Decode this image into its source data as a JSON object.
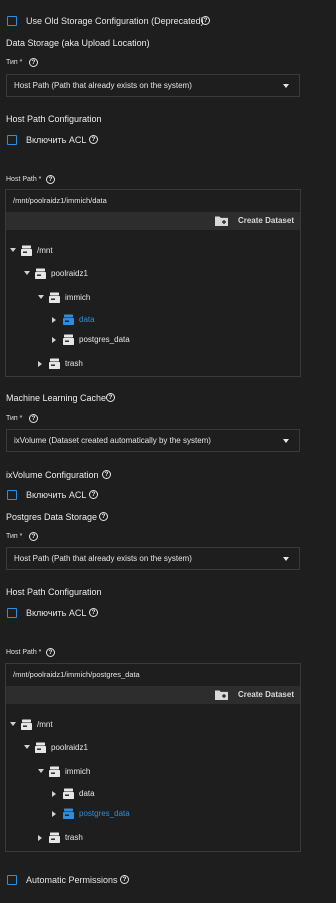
{
  "accent_color": "#2f8ddd",
  "old_storage": {
    "label": "Use Old Storage Configuration (Deprecated)",
    "checked": false
  },
  "data_storage": {
    "title": "Data Storage (aka Upload Location)",
    "type_label": "Тип *",
    "type_value": "Host Path (Path that already exists on the system)",
    "host_path_config_title": "Host Path Configuration",
    "acl_label": "Включить ACL",
    "host_path_label": "Host Path *",
    "host_path_value": "/mnt/poolraidz1/immich/data",
    "create_dataset_label": "Create Dataset",
    "tree": [
      {
        "name": "/mnt",
        "expanded": true,
        "selected": false
      },
      {
        "name": "poolraidz1",
        "expanded": true,
        "selected": false
      },
      {
        "name": "immich",
        "expanded": true,
        "selected": false
      },
      {
        "name": "data",
        "expanded": false,
        "selected": true
      },
      {
        "name": "postgres_data",
        "expanded": false,
        "selected": false
      },
      {
        "name": "trash",
        "expanded": false,
        "selected": false
      }
    ]
  },
  "ml_cache": {
    "title": "Machine Learning Cache",
    "type_label": "Тип *",
    "type_value": "ixVolume (Dataset created automatically by the system)",
    "ixvolume_config_title": "ixVolume Configuration",
    "acl_label": "Включить ACL"
  },
  "postgres_storage": {
    "title": "Postgres Data Storage",
    "type_label": "Тип *",
    "type_value": "Host Path (Path that already exists on the system)",
    "host_path_config_title": "Host Path Configuration",
    "acl_label": "Включить ACL",
    "host_path_label": "Host Path *",
    "host_path_value": "/mnt/poolraidz1/immich/postgres_data",
    "create_dataset_label": "Create Dataset",
    "tree": [
      {
        "name": "/mnt",
        "expanded": true,
        "selected": false
      },
      {
        "name": "poolraidz1",
        "expanded": true,
        "selected": false
      },
      {
        "name": "immich",
        "expanded": true,
        "selected": false
      },
      {
        "name": "data",
        "expanded": false,
        "selected": false
      },
      {
        "name": "postgres_data",
        "expanded": false,
        "selected": true
      },
      {
        "name": "trash",
        "expanded": false,
        "selected": false
      }
    ]
  },
  "automatic_permissions": {
    "label": "Automatic Permissions",
    "checked": false
  },
  "help_glyph": "?"
}
